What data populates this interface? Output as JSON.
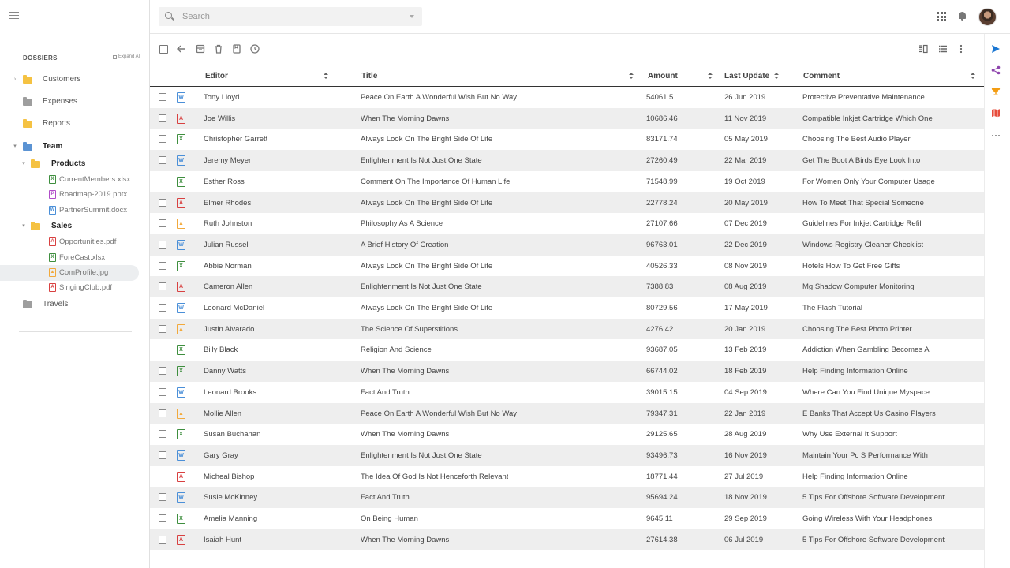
{
  "sidebar": {
    "heading": "DOSSIERS",
    "expand_all": "Expand All",
    "tree": [
      {
        "label": "Customers",
        "kind": "folder",
        "color": "#f5c242",
        "level": 0,
        "caret": "right"
      },
      {
        "label": "Expenses",
        "kind": "folder",
        "color": "#9e9e9e",
        "level": 0,
        "caret": "none"
      },
      {
        "label": "Reports",
        "kind": "folder",
        "color": "#f5c242",
        "level": 0,
        "caret": "none"
      },
      {
        "label": "Team",
        "kind": "folder",
        "color": "#5b93d3",
        "level": 0,
        "caret": "down"
      },
      {
        "label": "Products",
        "kind": "folder",
        "color": "#f5c242",
        "level": 1,
        "caret": "down"
      },
      {
        "label": "CurrentMembers.xlsx",
        "kind": "xls",
        "level": 2
      },
      {
        "label": "Roadmap-2019.pptx",
        "kind": "ppt",
        "level": 2
      },
      {
        "label": "PartnerSummit.docx",
        "kind": "doc",
        "level": 2
      },
      {
        "label": "Sales",
        "kind": "folder",
        "color": "#f5c242",
        "level": 1,
        "caret": "down"
      },
      {
        "label": "Opportunities.pdf",
        "kind": "pdf",
        "level": 2
      },
      {
        "label": "ForeCast.xlsx",
        "kind": "xls",
        "level": 2
      },
      {
        "label": "ComProfile.jpg",
        "kind": "img",
        "level": 2,
        "selected": true
      },
      {
        "label": "SingingClub.pdf",
        "kind": "pdf",
        "level": 2
      },
      {
        "label": "Travels",
        "kind": "folder",
        "color": "#9e9e9e",
        "level": 0,
        "caret": "none"
      }
    ]
  },
  "search": {
    "placeholder": "Search"
  },
  "table": {
    "columns": [
      "Editor",
      "Title",
      "Amount",
      "Last Update",
      "Comment"
    ],
    "rows": [
      {
        "type": "doc",
        "editor": "Tony Lloyd",
        "title": "Peace On Earth A Wonderful Wish But No Way",
        "amount": "54061.5",
        "date": "26 Jun 2019",
        "comment": "Protective Preventative Maintenance"
      },
      {
        "type": "pdf",
        "editor": "Joe Willis",
        "title": "When The Morning Dawns",
        "amount": "10686.46",
        "date": "11 Nov 2019",
        "comment": "Compatible Inkjet Cartridge Which One"
      },
      {
        "type": "xls",
        "editor": "Christopher Garrett",
        "title": "Always Look On The Bright Side Of Life",
        "amount": "83171.74",
        "date": "05 May 2019",
        "comment": "Choosing The Best Audio Player"
      },
      {
        "type": "doc",
        "editor": "Jeremy Meyer",
        "title": "Enlightenment Is Not Just One State",
        "amount": "27260.49",
        "date": "22 Mar 2019",
        "comment": "Get The Boot A Birds Eye Look Into"
      },
      {
        "type": "xls",
        "editor": "Esther Ross",
        "title": "Comment On The Importance Of Human Life",
        "amount": "71548.99",
        "date": "19 Oct 2019",
        "comment": "For Women Only Your Computer Usage"
      },
      {
        "type": "pdf",
        "editor": "Elmer Rhodes",
        "title": "Always Look On The Bright Side Of Life",
        "amount": "22778.24",
        "date": "20 May 2019",
        "comment": "How To Meet That Special Someone"
      },
      {
        "type": "img",
        "editor": "Ruth Johnston",
        "title": "Philosophy As A Science",
        "amount": "27107.66",
        "date": "07 Dec 2019",
        "comment": "Guidelines For Inkjet Cartridge Refill"
      },
      {
        "type": "doc",
        "editor": "Julian Russell",
        "title": "A Brief History Of Creation",
        "amount": "96763.01",
        "date": "22 Dec 2019",
        "comment": "Windows Registry Cleaner Checklist"
      },
      {
        "type": "xls",
        "editor": "Abbie Norman",
        "title": "Always Look On The Bright Side Of Life",
        "amount": "40526.33",
        "date": "08 Nov 2019",
        "comment": "Hotels How To Get Free Gifts"
      },
      {
        "type": "pdf",
        "editor": "Cameron Allen",
        "title": "Enlightenment Is Not Just One State",
        "amount": "7388.83",
        "date": "08 Aug 2019",
        "comment": "Mg Shadow Computer Monitoring"
      },
      {
        "type": "doc",
        "editor": "Leonard McDaniel",
        "title": "Always Look On The Bright Side Of Life",
        "amount": "80729.56",
        "date": "17 May 2019",
        "comment": "The Flash Tutorial"
      },
      {
        "type": "img",
        "editor": "Justin Alvarado",
        "title": "The Science Of Superstitions",
        "amount": "4276.42",
        "date": "20 Jan 2019",
        "comment": "Choosing The Best Photo Printer"
      },
      {
        "type": "xls",
        "editor": "Billy Black",
        "title": "Religion And Science",
        "amount": "93687.05",
        "date": "13 Feb 2019",
        "comment": "Addiction When Gambling Becomes A"
      },
      {
        "type": "xls",
        "editor": "Danny Watts",
        "title": "When The Morning Dawns",
        "amount": "66744.02",
        "date": "18 Feb 2019",
        "comment": "Help Finding Information Online"
      },
      {
        "type": "doc",
        "editor": "Leonard Brooks",
        "title": "Fact And Truth",
        "amount": "39015.15",
        "date": "04 Sep 2019",
        "comment": "Where Can You Find Unique Myspace"
      },
      {
        "type": "img",
        "editor": "Mollie Allen",
        "title": "Peace On Earth A Wonderful Wish But No Way",
        "amount": "79347.31",
        "date": "22 Jan 2019",
        "comment": "E Banks That Accept Us Casino Players"
      },
      {
        "type": "xls",
        "editor": "Susan Buchanan",
        "title": "When The Morning Dawns",
        "amount": "29125.65",
        "date": "28 Aug 2019",
        "comment": "Why Use External It Support"
      },
      {
        "type": "doc",
        "editor": "Gary Gray",
        "title": "Enlightenment Is Not Just One State",
        "amount": "93496.73",
        "date": "16 Nov 2019",
        "comment": "Maintain Your Pc S Performance With"
      },
      {
        "type": "pdf",
        "editor": "Micheal Bishop",
        "title": "The Idea Of God Is Not Henceforth Relevant",
        "amount": "18771.44",
        "date": "27 Jul 2019",
        "comment": "Help Finding Information Online"
      },
      {
        "type": "doc",
        "editor": "Susie McKinney",
        "title": "Fact And Truth",
        "amount": "95694.24",
        "date": "18 Nov 2019",
        "comment": "5 Tips For Offshore Software Development"
      },
      {
        "type": "xls",
        "editor": "Amelia Manning",
        "title": "On Being Human",
        "amount": "9645.11",
        "date": "29 Sep 2019",
        "comment": "Going Wireless With Your Headphones"
      },
      {
        "type": "pdf",
        "editor": "Isaiah Hunt",
        "title": "When The Morning Dawns",
        "amount": "27614.38",
        "date": "06 Jul 2019",
        "comment": "5 Tips For Offshore Software Development"
      }
    ]
  },
  "icons": {
    "toolbar": [
      "checkbox-icon",
      "back-arrow-icon",
      "archive-icon",
      "trash-icon",
      "bookmark-icon",
      "clock-icon",
      "reader-view-icon",
      "list-view-icon",
      "more-vert-icon"
    ],
    "rail": [
      "send-icon",
      "share-icon",
      "trophy-icon",
      "map-icon",
      "more-horiz-icon"
    ]
  },
  "colors": {
    "xls": "#3e8e3e",
    "ppt": "#b04cc8",
    "doc": "#4a8fd8",
    "pdf": "#d84040",
    "img": "#f2a93b",
    "accent": "#1976d2"
  }
}
